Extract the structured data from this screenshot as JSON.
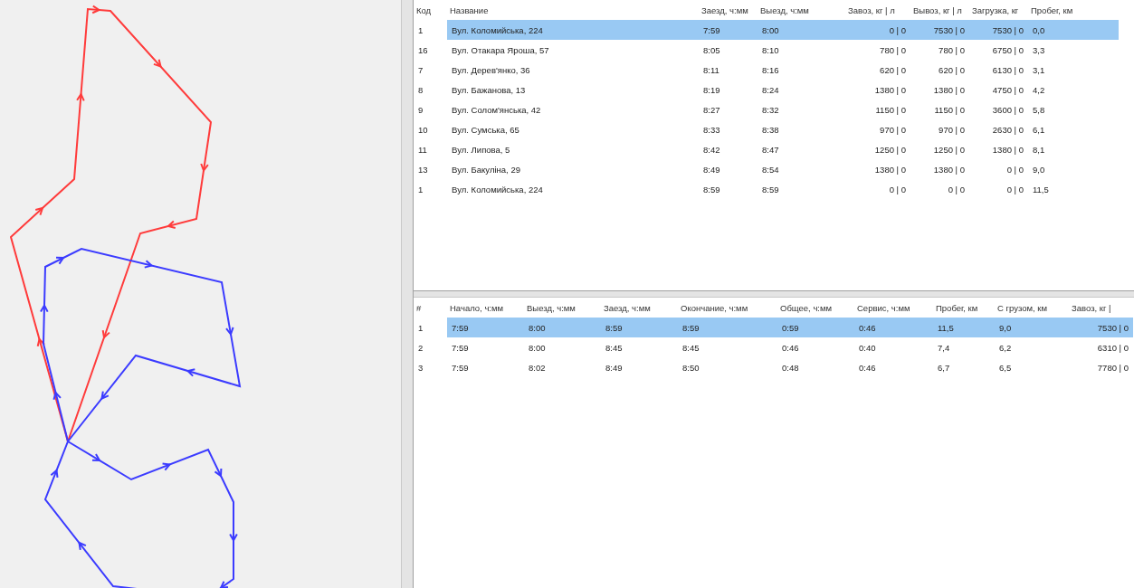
{
  "map": {
    "routes": [
      {
        "color": "#ff3b3b"
      },
      {
        "color": "#3b3bff"
      },
      {
        "color": "#3b3bff"
      }
    ]
  },
  "stops_table": {
    "columns": [
      "Код",
      "Название",
      "Заезд, ч:мм",
      "Выезд, ч:мм",
      "Завоз, кг | л",
      "Вывоз, кг | л",
      "Загрузка, кг",
      "Пробег, км"
    ],
    "rows": [
      {
        "selected": true,
        "cells": [
          "1",
          "Вул. Коломийська, 224",
          "7:59",
          "8:00",
          "0 | 0",
          "7530 | 0",
          "7530 | 0",
          "0,0"
        ]
      },
      {
        "selected": false,
        "cells": [
          "16",
          "Вул. Отакара Яроша, 57",
          "8:05",
          "8:10",
          "780 | 0",
          "780 | 0",
          "6750 | 0",
          "3,3"
        ]
      },
      {
        "selected": false,
        "cells": [
          "7",
          "Вул. Дерев'янко, 36",
          "8:11",
          "8:16",
          "620 | 0",
          "620 | 0",
          "6130 | 0",
          "3,1"
        ]
      },
      {
        "selected": false,
        "cells": [
          "8",
          "Вул. Бажанова, 13",
          "8:19",
          "8:24",
          "1380 | 0",
          "1380 | 0",
          "4750 | 0",
          "4,2"
        ]
      },
      {
        "selected": false,
        "cells": [
          "9",
          "Вул. Солом'янська, 42",
          "8:27",
          "8:32",
          "1150 | 0",
          "1150 | 0",
          "3600 | 0",
          "5,8"
        ]
      },
      {
        "selected": false,
        "cells": [
          "10",
          "Вул. Сумська, 65",
          "8:33",
          "8:38",
          "970 | 0",
          "970 | 0",
          "2630 | 0",
          "6,1"
        ]
      },
      {
        "selected": false,
        "cells": [
          "11",
          "Вул. Липова, 5",
          "8:42",
          "8:47",
          "1250 | 0",
          "1250 | 0",
          "1380 | 0",
          "8,1"
        ]
      },
      {
        "selected": false,
        "cells": [
          "13",
          "Вул. Бакуліна, 29",
          "8:49",
          "8:54",
          "1380 | 0",
          "1380 | 0",
          "0 | 0",
          "9,0"
        ]
      },
      {
        "selected": false,
        "cells": [
          "1",
          "Вул. Коломийська, 224",
          "8:59",
          "8:59",
          "0 | 0",
          "0 | 0",
          "0 | 0",
          "11,5"
        ]
      }
    ]
  },
  "routes_table": {
    "columns": [
      "#",
      "Начало, ч:мм",
      "Выезд, ч:мм",
      "Заезд, ч:мм",
      "Окончание, ч:мм",
      "Общее, ч:мм",
      "Сервис, ч:мм",
      "Пробег, км",
      "С грузом, км",
      "Завоз, кг |"
    ],
    "rows": [
      {
        "selected": true,
        "cells": [
          "1",
          "7:59",
          "8:00",
          "8:59",
          "8:59",
          "0:59",
          "0:46",
          "11,5",
          "9,0",
          "7530 | 0"
        ]
      },
      {
        "selected": false,
        "cells": [
          "2",
          "7:59",
          "8:00",
          "8:45",
          "8:45",
          "0:46",
          "0:40",
          "7,4",
          "6,2",
          "6310 | 0"
        ]
      },
      {
        "selected": false,
        "cells": [
          "3",
          "7:59",
          "8:02",
          "8:49",
          "8:50",
          "0:48",
          "0:46",
          "6,7",
          "6,5",
          "7780 | 0"
        ]
      }
    ]
  }
}
